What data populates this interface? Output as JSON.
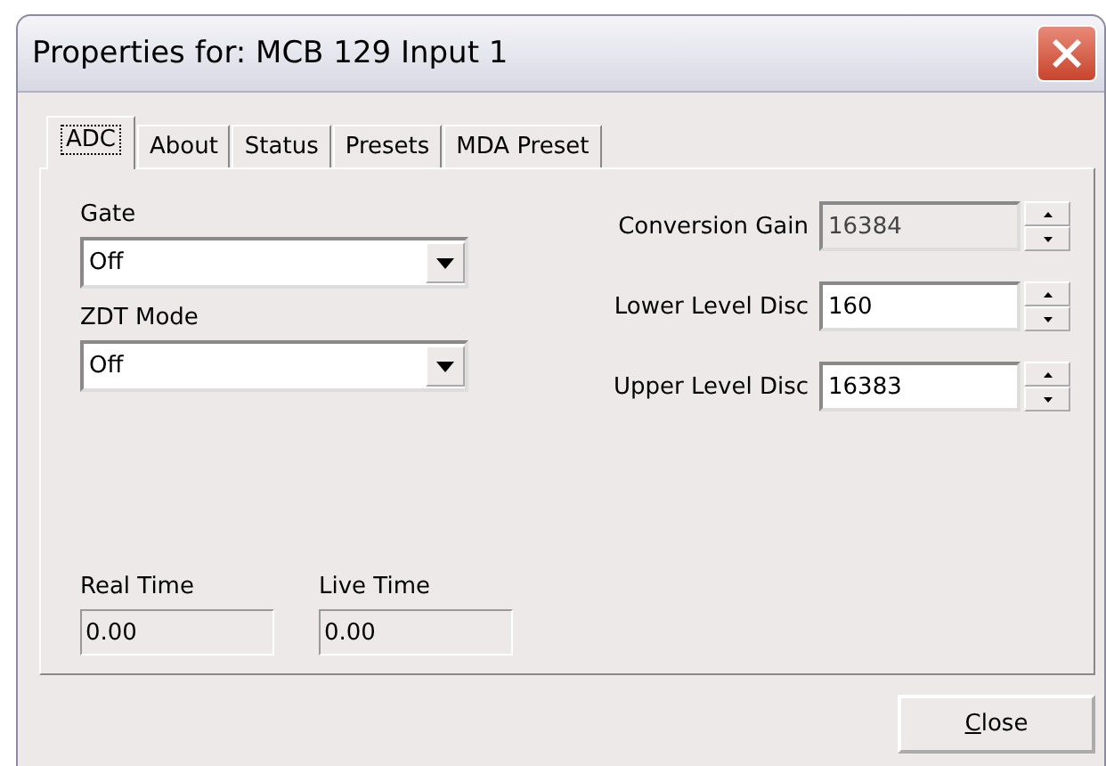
{
  "window": {
    "title": "Properties for: MCB 129 Input 1"
  },
  "tabs": [
    {
      "label": "ADC",
      "selected": true
    },
    {
      "label": "About",
      "selected": false
    },
    {
      "label": "Status",
      "selected": false
    },
    {
      "label": "Presets",
      "selected": false
    },
    {
      "label": "MDA Preset",
      "selected": false
    }
  ],
  "dropdowns": [
    {
      "label": "Gate",
      "value": "Off"
    },
    {
      "label": "ZDT Mode",
      "value": "Off"
    }
  ],
  "spin_fields": [
    {
      "label": "Conversion Gain",
      "value": "16384",
      "disabled": true
    },
    {
      "label": "Lower Level Disc",
      "value": "160",
      "disabled": false
    },
    {
      "label": "Upper Level Disc",
      "value": "16383",
      "disabled": false
    }
  ],
  "time_fields": [
    {
      "label": "Real Time",
      "value": "0.00"
    },
    {
      "label": "Live Time",
      "value": "0.00"
    }
  ],
  "close_button": {
    "label": "Close",
    "mnemonic_underlined": true
  }
}
